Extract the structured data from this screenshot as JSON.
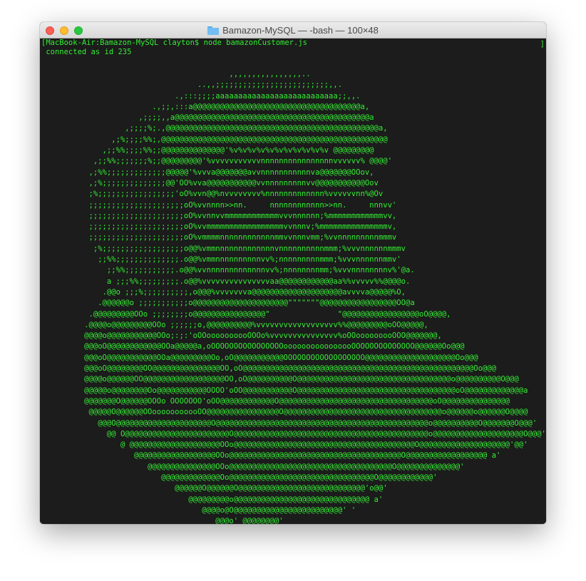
{
  "window": {
    "title": "Bamazon-MySQL — -bash — 100×48",
    "title_icon": "folder-icon"
  },
  "terminal": {
    "prompt_line": "[MacBook-Air:Bamazon-MySQL clayton$ node bamazonCustomer.js",
    "status_line": " connected as id 235",
    "right_bracket": "]",
    "text_color": "#33ee33",
    "background": "#1c1c1c"
  },
  "ascii_art": [
    "                                         ,,,,,,,,,,,,,,,,..",
    "                                  ..,,;;;;;;;;;;;;;;;;;;;;;;;;;,,.",
    "                             .,:::;;;;aaaaaaaaaaaaaaaaaaaaaaaaaaa;;,,.",
    "                        .,;;,:::a@@@@@@@@@@@@@@@@@@@@@@@@@@@@@@@@@@@@@a,",
    "                     ,;;;;,,a@@@@@@@@@@@@@@@@@@@@@@@@@@@@@@@@@@@@@@@@@@@a",
    "                  ,;;;;%;.,@@@@@@@@@@@@@@@@@@@@@@@@@@@@@@@@@@@@@@@@@@@@@@@a,",
    "               ,;%;;;;%%;,@@@@@@@@@@@@@@@@@@@@@@@@@@@@@@@@@@@@@@@@@@@@@@@@@@",
    "             ,;;%%;;;;%%;;@@@@@@@@@@@@@@'%v%v%v%v%v%v%v%v%v%v%v @@@@@@@@@",
    "           ,;;%%;;;;;;;%;;@@@@@@@@@'%vvvvvvvvvvvnnnnnnnnnnnnnnnnvvvvvv% @@@@'",
    "          ,;%%;;;;;;;;;;;;;@@@@@'%vvva@@@@@@@avvnnnnnnnnnnnva@@@@@@@OOov,",
    "          ,;%;;;;;;;;;;;;;;@@'OO%vva@@@@@@@@@@@vvnnnnnnnnnvv@@@@@@@@@@@Oov",
    "          ;%;;;;;;;;;;;;;;;;;'oO%vvn@@%nvvvvvvvv%nnnnnnnnnnnnn%vvvvvvnn%@Ov",
    "          ;;;;;;;;;;;;;;;;;;;;;oO%vvnnnn>>nn.     nnnnnnnnnnnn>>nn.     nnnvv'",
    "          ;;;;;;;;;;;;;;;;;;;;;oO%vvnnvvmmmmmmmmmmmmvvvnnnnnn;%mmmmmmmmmmmmvv,",
    "          ;;;;;;;;;;;;;;;;;;;;;oO%vvmmmmmmmmmmmmmmmmmvvnnnv;%mmmmmmmmmmmmmmmv,",
    "          ;;;;;;;;;;;;;;;;;;;;;oO%vmmmmnnnnnnnnnnnnmmvvnnnvmm;%vvnnnnnnnnnmmmv",
    "           ;%;;;;;;;;;;;;;;;;;;o@@%vmmnnnnnnnnnnnnnvnnnnnnnnnnmmm;%vvvnnnnnnmmmv",
    "            ;;%%;;;;;;;;;;;;;;.o@@%vmmnnnnnnnnnnvv%;nnnnnnnnnmmm;%vvvnnnnnnmmv'",
    "              ;;%%;;;;;;;;;;;.o@@%vvnnnnnnnnnnnnnvv%;nnnnnnnnmm;%vvvnnnnnnnnv%'@a.",
    "              a ;;;%%;;;;;;;;;.o@@%vvvvvvvvvvvvvvvaa@@@@@@@@@@@@aa%%vvvvv%%@@@@o.",
    "             .@@o ;;;%;;;;;;;;;;,o@@@%vvvvvvva@@@@@@@@@@@@@@@@@@@@avvvva@@@@@%O,",
    "            .@@@@@@o ;;;;;;;;;;;o@@@@@@@@@@@@@@@@@@@@@\"\"\"\"\"\"\"@@@@@@@@@@@@@@@@@OO@a",
    "          .@@@@@@@@@OOo ;;;;;;;;o@@@@@@@@@@@@@@@@\"               \"@@@@@@@@@@@@@@@@@oO@@@@,",
    "         .@@@@o@@@@@@@@@OOo ;;;;;;o,@@@@@@@@@@%vvvvvvvvvvvvvvvvvv%%@@@@@@@@@oOO@@@@@,",
    "         @@@@o@@@@@@@@@@@OOo;:;:'oOOoooooooooOOOo%vvvvvvvvvvvvvvv%oOOooooooooOOO@@@@@@@,",
    "         @@@oO@@@@@@@@@@@@OOa@@@@@a,oOOOOOOOOOOOOOOOOoooooooooooooooOOOOOOOOOOOOOO@@@@@@Oo@@@",
    "         @@@oO@@@@@@@@@@@OOa@@@@@@@@@Oo,oO@@@@@@@@@@@OOOOOOOOOOOOOOOOOO@@@@@@@@@@@@@@@@@@@@Oo@@@",
    "         @@@oO@@@@@@@@OO@@@@@@@@@@@@@@@OO,oO@@@@@@@@@@@@@@@@@@@@@@@@@@@@@@@@@@@@@@@@@@@@@@@@@@@Oo@@@",
    "         @@@@o@@@@@@OO@@@@@@@@@@@@@@@@@@OO,oO@@@@@@@@@@O@@@@@@@@@@@@@@@@@@@@@@@@@@@@@@@@@@o@@@@@@@@@@O@@@",
    "         @@@@@o@@@@@@@@Oo@@@@@@@@@@@OOOO'oOO@@@@@@@@@@@O@@@@@@@@@@@@@@@@@@@@@@@@@@@@@@@@@@@oO@@@@@@@@@@@@@a",
    "         @@@@@@@O@@@@@@OOOo OOOOOOO'oOO@@@@@@@@@@@@O@@@@@@@@@@@@@@@@@@@@@@@@@@@@@@@@@@oO@@@@@@@@@@@@@@@",
    "          @@@@@O@@@@@@OOooooooooooOO@@@@@@@@@@@@@@@@O@@@@@@@@@@@@@@@@@@@@@@@@@@@@@@@@@@@o@@@@@@o@@@@@@O@@@@",
    "            @@@O@@@@@@@@@@@@@@@@@@@@@O@@@@@@@@@@@@@@@@@@@@@@@@@@@@@@@@@@@@@@@@@@@@@@@o@@@@@@@@@@O@@@@@@@O@@@'",
    "              @@ O@@@@@@@@@@@@@@@@@@@@@@@O@@@@@@@@@@@@@@@@@@@@@@@@@@@@@@@@@@@@@@@@@@@o@@@@@@@@@@@@@@@@@@@@O@@@'",
    "                 @ @@@@@@@@@@@@@@@@@@@@OOo@@@@@@@@@@@@@@@@@@@@@@@@@@@@@@@@@@@@@@@@O@@@@@@@@@@@@@@@@@@@@'@@'",
    "                    @@@@@@@@@@@@@@@@@@OOo@@@@@@@@@@@@@@@@@@@@@@@@@@@@@@@@@@@@@@O@@@@@@@@@@@@@@@@@@ a'",
    "                       @@@@@@@@@@@@@@@OOo@@@@@@@@@@@@@@@@@@@@@@@@@@@@@@@@@@@@O@@@@@@@@@@@@@@'",
    "                          @@@@@@@@@@@@@Oo@@@@@@@@@@@@@@@@@@@@@@@@@@@@@@@@O@@@@@@@@@@@@'",
    "                             @@@@@@O@@@@@@O@@@@@@@@@@@@@@@@@@@@@@@@@@@@'o@@'",
    "                                @@@@@@@@@o@@@@@@@@@@@@@@@@@@@@@@@@@@@@@@ a'",
    "                                   @@@@o@O@@@@@@@@@@@@@@@@@@@@@@@@' '",
    "                                      @@@o' @@@@@@@@'",
    "                                         @' .@@@@'",
    "                                            @@'"
  ]
}
